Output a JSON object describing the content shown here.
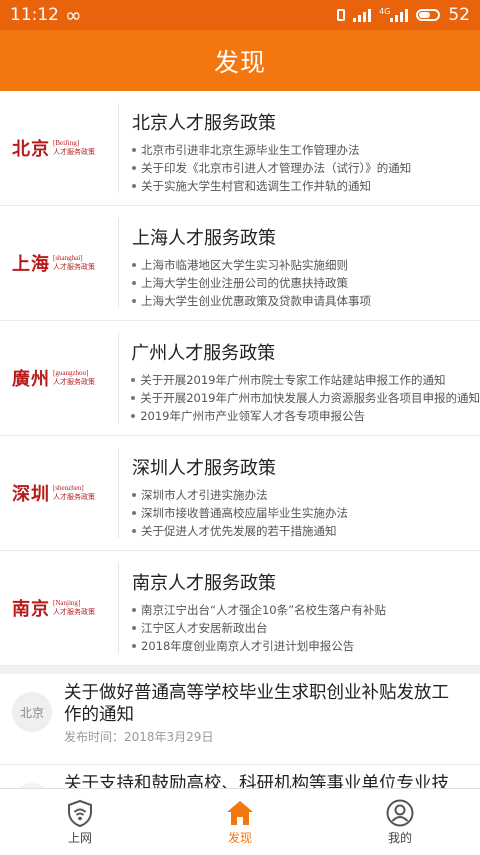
{
  "status_bar": {
    "time": "11:12",
    "network": "4G",
    "battery": "52"
  },
  "header": {
    "title": "发现"
  },
  "policies": [
    {
      "city": "北京",
      "pinyin": "[BeiJing]",
      "logo_sub": "人才服务政策",
      "title": "北京人才服务政策",
      "items": [
        "北京市引进非北京生源毕业生工作管理办法",
        "关于印发《北京市引进人才管理办法（试行）》的通知",
        "关于实施大学生村官和选调生工作并轨的通知"
      ]
    },
    {
      "city": "上海",
      "pinyin": "[shanghai]",
      "logo_sub": "人才服务政策",
      "title": "上海人才服务政策",
      "items": [
        "上海市临港地区大学生实习补贴实施细则",
        "上海大学生创业注册公司的优惠扶持政策",
        "上海大学生创业优惠政策及贷款申请具体事项"
      ]
    },
    {
      "city": "廣州",
      "pinyin": "[guangzhou]",
      "logo_sub": "人才服务政策",
      "title": "广州人才服务政策",
      "items": [
        "关于开展2019年广州市院士专家工作站建站申报工作的通知",
        "关于开展2019年广州市加快发展人力资源服务业各项目申报的通知",
        "2019年广州市产业领军人才各专项申报公告"
      ]
    },
    {
      "city": "深圳",
      "pinyin": "[shenzhen]",
      "logo_sub": "人才服务政策",
      "title": "深圳人才服务政策",
      "items": [
        "深圳市人才引进实施办法",
        "深圳市接收普通高校应届毕业生实施办法",
        "关于促进人才优先发展的若干措施通知"
      ]
    },
    {
      "city": "南京",
      "pinyin": "[Nanjing]",
      "logo_sub": "人才服务政策",
      "title": "南京人才服务政策",
      "items": [
        "南京江宁出台“人才强企10条”名校生落户有补贴",
        "江宁区人才安居新政出台",
        "2018年度创业南京人才引进计划申报公告"
      ]
    }
  ],
  "news": [
    {
      "tag": "北京",
      "title": "关于做好普通高等学校毕业生求职创业补贴发放工作的通知",
      "date": "发布时间：2018年3月29日"
    },
    {
      "tag": "",
      "title": "关于支持和鼓励高校、科研机构等事业单位专业技",
      "date": ""
    }
  ],
  "tabs": [
    {
      "label": "上网",
      "icon": "wifi-shield-icon",
      "active": false
    },
    {
      "label": "发现",
      "icon": "home-icon",
      "active": true
    },
    {
      "label": "我的",
      "icon": "user-icon",
      "active": false
    }
  ],
  "colors": {
    "accent": "#f4760f",
    "status": "#e9630c",
    "logo_red": "#b71c1c"
  }
}
